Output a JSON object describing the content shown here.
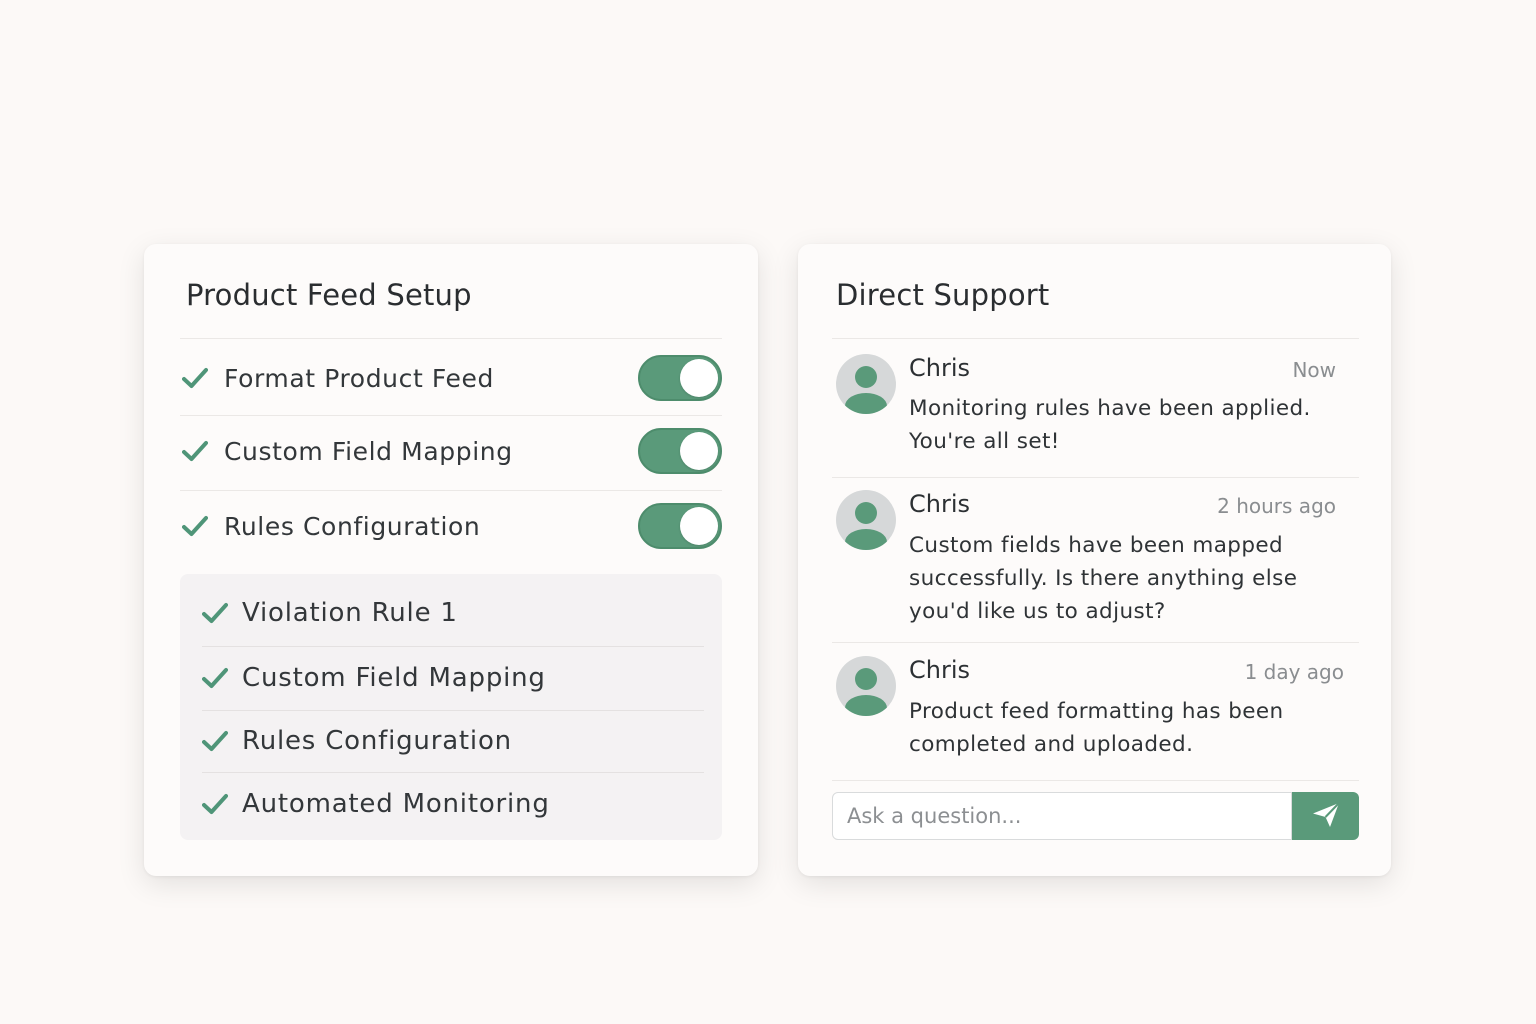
{
  "colors": {
    "accent": "#5a9a7a",
    "background": "#fcf9f7",
    "card": "#fdfbfa",
    "subpanel": "#f4f2f3"
  },
  "setup": {
    "title": "Product Feed Setup",
    "items": [
      {
        "label": "Format Product Feed",
        "icon": "check-icon",
        "toggle_on": true
      },
      {
        "label": "Custom Field Mapping",
        "icon": "check-icon",
        "toggle_on": true
      },
      {
        "label": "Rules Configuration",
        "icon": "check-icon",
        "toggle_on": true
      }
    ],
    "subitems": [
      {
        "label": "Violation Rule 1",
        "icon": "check-icon"
      },
      {
        "label": "Custom Field Mapping",
        "icon": "check-icon"
      },
      {
        "label": "Rules Configuration",
        "icon": "check-icon"
      },
      {
        "label": "Automated Monitoring",
        "icon": "check-icon"
      }
    ]
  },
  "support": {
    "title": "Direct Support",
    "messages": [
      {
        "name": "Chris",
        "time": "Now",
        "text": "Monitoring rules have been applied. You're all set!",
        "avatar": "user-avatar-icon"
      },
      {
        "name": "Chris",
        "time": "2 hours ago",
        "text": "Custom fields have been mapped successfully. Is there anything else you'd like us to adjust?",
        "avatar": "user-avatar-icon"
      },
      {
        "name": "Chris",
        "time": "1 day ago",
        "text": "Product feed formatting has been completed and uploaded.",
        "avatar": "user-avatar-icon"
      }
    ],
    "input_placeholder": "Ask a question...",
    "send_icon": "paper-plane-icon"
  }
}
